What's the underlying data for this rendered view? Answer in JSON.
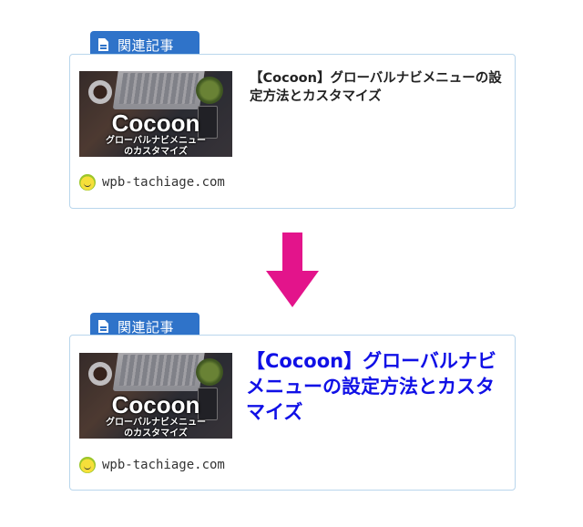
{
  "label": "関連記事",
  "card_top": {
    "thumb_title": "Cocoon",
    "thumb_subtitle_line1": "グローバルナビメニュー",
    "thumb_subtitle_line2": "のカスタマイズ",
    "title": "【Cocoon】グローバルナビメニューの設定方法とカスタマイズ",
    "site": "wpb-tachiage.com"
  },
  "card_bottom": {
    "thumb_title": "Cocoon",
    "thumb_subtitle_line1": "グローバルナビメニュー",
    "thumb_subtitle_line2": "のカスタマイズ",
    "title": "【Cocoon】グローバルナビメニューの設定方法とカスタマイズ",
    "site": "wpb-tachiage.com"
  },
  "colors": {
    "arrow": "#e3148b",
    "tag": "#2f73c9",
    "title_highlight": "#1010e6"
  }
}
